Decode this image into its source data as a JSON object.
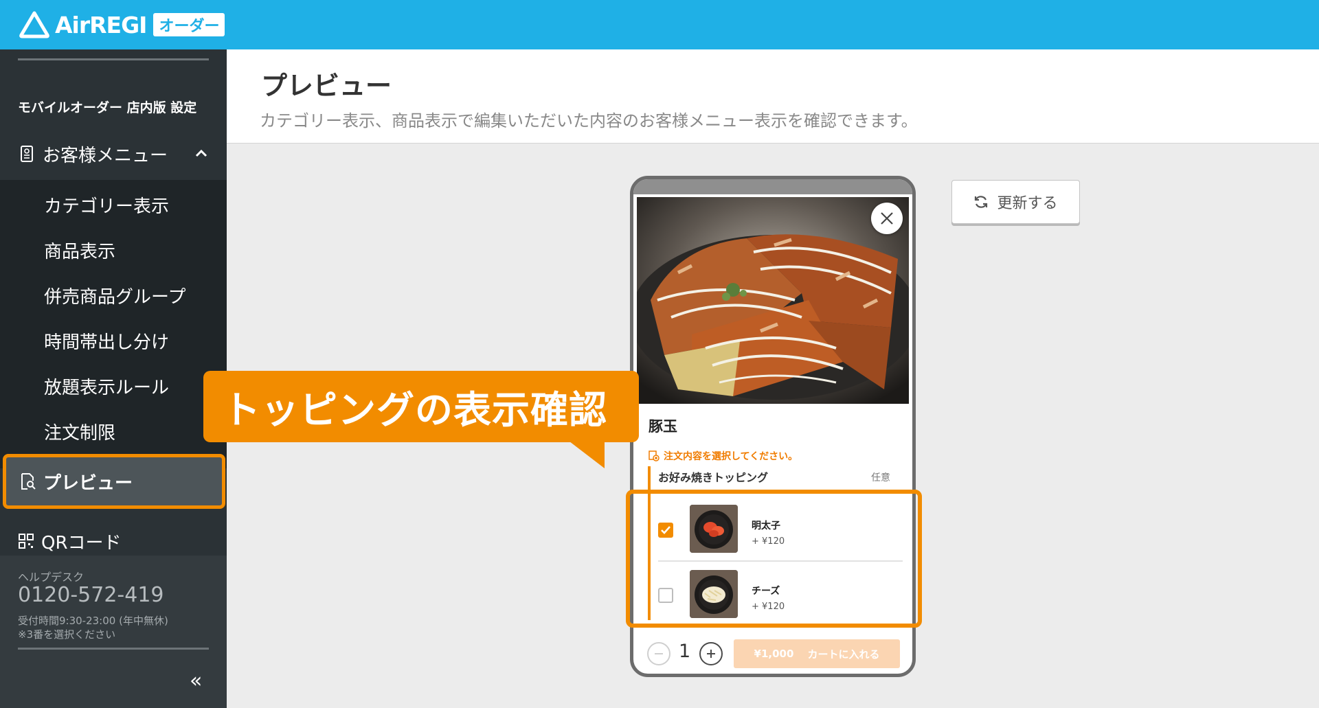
{
  "header": {
    "logo_text": "AirREGI",
    "logo_badge": "オーダー"
  },
  "sidebar": {
    "heading": "モバイルオーダー 店内版 設定",
    "parent_label": "お客様メニュー",
    "sub_items": [
      {
        "label": "カテゴリー表示"
      },
      {
        "label": "商品表示"
      },
      {
        "label": "併売商品グループ"
      },
      {
        "label": "時間帯出し分け"
      },
      {
        "label": "放題表示ルール"
      },
      {
        "label": "注文制限"
      }
    ],
    "active_label": "プレビュー",
    "qr_label": "QRコード",
    "help": {
      "label": "ヘルプデスク",
      "phone": "0120-572-419",
      "hours": "受付時間9:30-23:00 (年中無休)",
      "note": "※3番を選択ください"
    },
    "collapse_label": "«"
  },
  "page": {
    "title": "プレビュー",
    "description": "カテゴリー表示、商品表示で編集いただいた内容のお客様メニュー表示を確認できます。"
  },
  "refresh_label": "更新する",
  "callout_text": "トッピングの表示確認",
  "preview": {
    "item_name": "豚玉",
    "notice": "注文内容を選択してください。",
    "topping_group": "お好み焼きトッピング",
    "optional_label": "任意",
    "options": [
      {
        "name": "明太子",
        "price": "+ ¥120",
        "checked": true
      },
      {
        "name": "チーズ",
        "price": "+ ¥120",
        "checked": false
      }
    ],
    "quantity": "1",
    "cart_price": "¥1,000",
    "cart_label": "カートに入れる"
  },
  "colors": {
    "header": "#1fb0e6",
    "accent": "#f28c00",
    "sidebar": "#2b3236"
  }
}
